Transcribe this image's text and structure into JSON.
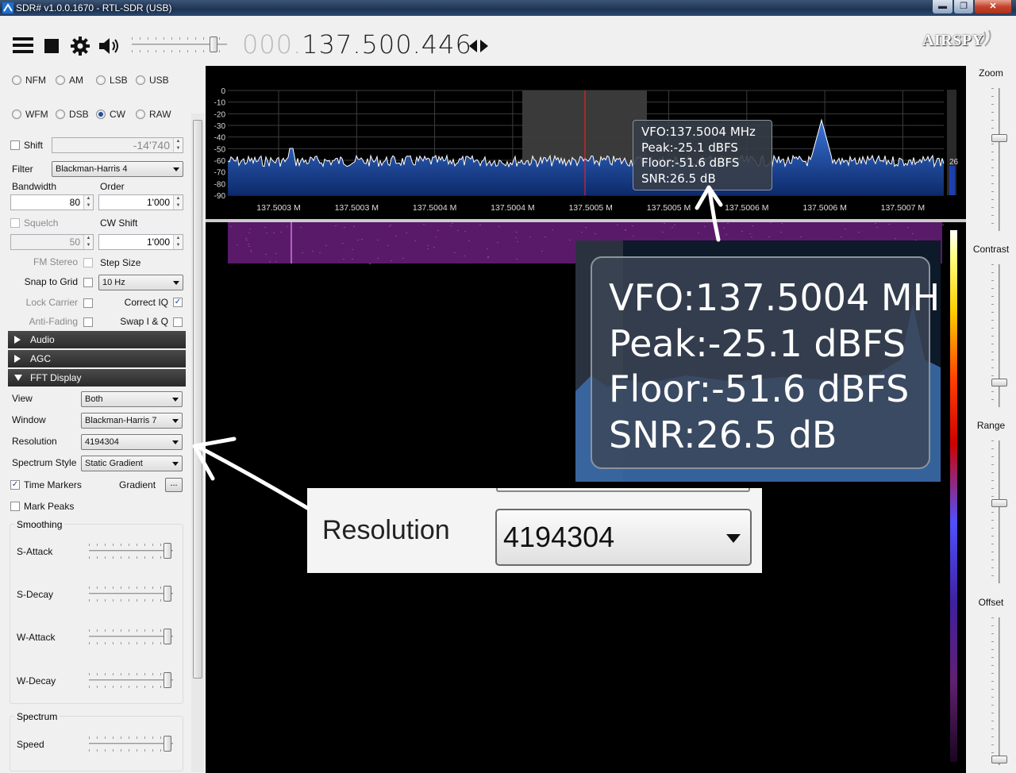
{
  "window": {
    "title": "SDR# v1.0.0.1670 - RTL-SDR (USB)",
    "min": "▬",
    "max": "❐",
    "close": "✕"
  },
  "toolbar": {
    "freq_dim": "000.",
    "freq_main": "137.500.446",
    "logo": "AIRSPY"
  },
  "modes": {
    "row1": [
      "NFM",
      "AM",
      "LSB",
      "USB"
    ],
    "row2": [
      "WFM",
      "DSB",
      "CW",
      "RAW"
    ],
    "selected": "CW"
  },
  "radio_panel": {
    "shift_label": "Shift",
    "shift_value": "-14'740",
    "filter_label": "Filter",
    "filter_value": "Blackman-Harris 4",
    "bandwidth_label": "Bandwidth",
    "bandwidth_value": "80",
    "order_label": "Order",
    "order_value": "1'000",
    "squelch_label": "Squelch",
    "squelch_value": "50",
    "cwshift_label": "CW Shift",
    "cwshift_value": "1'000",
    "fmstereo_label": "FM Stereo",
    "stepsize_label": "Step Size",
    "snap_label": "Snap to Grid",
    "step_value": "10 Hz",
    "lockcarrier_label": "Lock Carrier",
    "correctiq_label": "Correct IQ",
    "antifading_label": "Anti-Fading",
    "swapiq_label": "Swap I & Q",
    "correctiq_checked": "✓"
  },
  "sections": {
    "audio": "Audio",
    "agc": "AGC",
    "fft": "FFT Display"
  },
  "fft": {
    "view_label": "View",
    "view_value": "Both",
    "window_label": "Window",
    "window_value": "Blackman-Harris 7",
    "resolution_label": "Resolution",
    "resolution_value": "4194304",
    "style_label": "Spectrum Style",
    "style_value": "Static Gradient",
    "timemarkers_label": "Time Markers",
    "timemarkers_checked": "✓",
    "gradient_label": "Gradient",
    "gradient_btn": "...",
    "markpeaks_label": "Mark Peaks",
    "smoothing_title": "Smoothing",
    "sattack": "S-Attack",
    "sdecay": "S-Decay",
    "wattack": "W-Attack",
    "wdecay": "W-Decay",
    "spectrum_title": "Spectrum",
    "speed": "Speed"
  },
  "right_panel": {
    "zoom": "Zoom",
    "contrast": "Contrast",
    "range": "Range",
    "offset": "Offset"
  },
  "tooltip": {
    "vfo": "VFO:137.5004 MHz",
    "peak": "Peak:-25.1 dBFS",
    "floor": "Floor:-51.6 dBFS",
    "snr": "SNR:26.5 dB"
  },
  "zoom_res": {
    "label": "Resolution",
    "value": "4194304"
  },
  "spectrum_axis": {
    "y_ticks": [
      "0",
      "-10",
      "-20",
      "-30",
      "-40",
      "-50",
      "-60",
      "-70",
      "-80",
      "-90"
    ],
    "x_ticks": [
      "137.5003 M",
      "137.5003 M",
      "137.5004 M",
      "137.5004 M",
      "137.5005 M",
      "137.5005 M",
      "137.5006 M",
      "137.5006 M",
      "137.5007 M"
    ],
    "snr_meter": "26"
  },
  "colors": {
    "spectrum_fill": "#1d4ea8",
    "vfo_line": "#ff2020",
    "waterfall": "#5a1a6a"
  }
}
